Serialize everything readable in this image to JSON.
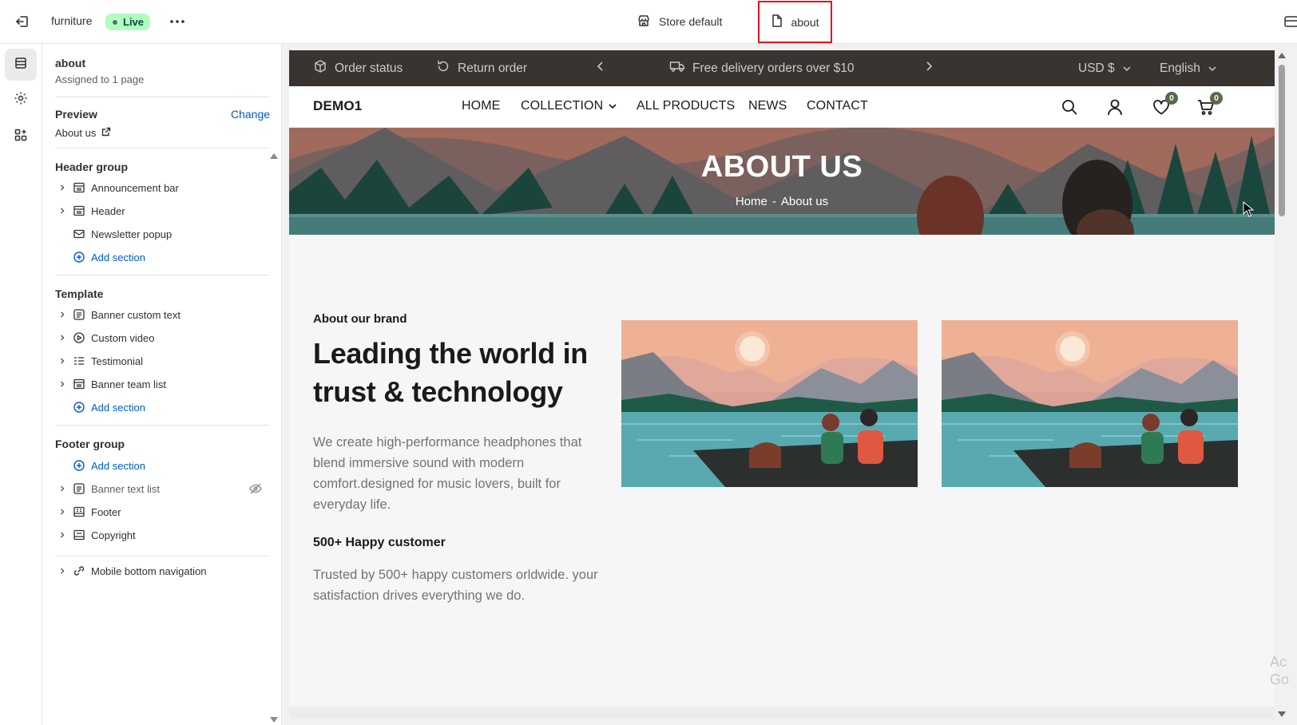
{
  "topbar": {
    "store_name": "furniture",
    "live_badge": "Live",
    "template_label": "Store default",
    "page_label": "about"
  },
  "sidebar": {
    "title": "about",
    "subtitle": "Assigned to 1 page",
    "preview_label": "Preview",
    "change_label": "Change",
    "preview_value": "About us",
    "header_group": {
      "title": "Header group",
      "items": [
        {
          "label": "Announcement bar",
          "icon": "layout-section-icon"
        },
        {
          "label": "Header",
          "icon": "layout-section-icon"
        },
        {
          "label": "Newsletter popup",
          "icon": "email-icon"
        }
      ],
      "add_label": "Add section"
    },
    "template_group": {
      "title": "Template",
      "items": [
        {
          "label": "Banner custom text",
          "icon": "text-block-icon"
        },
        {
          "label": "Custom video",
          "icon": "play-icon"
        },
        {
          "label": "Testimonial",
          "icon": "list-icon"
        },
        {
          "label": "Banner team list",
          "icon": "layout-section-icon"
        }
      ],
      "add_label": "Add section"
    },
    "footer_group": {
      "title": "Footer group",
      "add_label": "Add section",
      "items": [
        {
          "label": "Banner text list",
          "icon": "text-block-icon",
          "hidden": true
        },
        {
          "label": "Footer",
          "icon": "layout-footer-icon"
        },
        {
          "label": "Copyright",
          "icon": "layout-section-icon"
        }
      ]
    },
    "mobile_nav": {
      "label": "Mobile bottom navigation",
      "icon": "link-icon"
    }
  },
  "store": {
    "announcement": {
      "order_status": "Order status",
      "return_order": "Return order",
      "message": "Free delivery orders over $10",
      "currency": "USD $",
      "language": "English"
    },
    "logo": "DEMO1",
    "nav": [
      "HOME",
      "COLLECTION",
      "ALL PRODUCTS",
      "NEWS",
      "CONTACT"
    ],
    "wishlist_count": "0",
    "cart_count": "0",
    "hero": {
      "title": "ABOUT US",
      "crumb_home": "Home",
      "crumb_sep": "-",
      "crumb_current": "About us"
    },
    "brand": {
      "eyebrow": "About our brand",
      "heading": "Leading the world in trust & technology",
      "body": "We create high-performance headphones that blend immersive sound with modern comfort.designed for music lovers, built for everyday life.",
      "subheading": "500+ Happy customer",
      "body2": "Trusted by 500+ happy customers orldwide. your satisfaction drives everything we do."
    }
  },
  "watermark": {
    "line1": "Ac",
    "line2": "Go"
  },
  "colors": {
    "live_bg": "#affebf",
    "accent_link": "#005bd3",
    "announcement_bg": "#3a3431",
    "highlight_border": "#e0141e",
    "badge_bg": "#596b4a"
  }
}
